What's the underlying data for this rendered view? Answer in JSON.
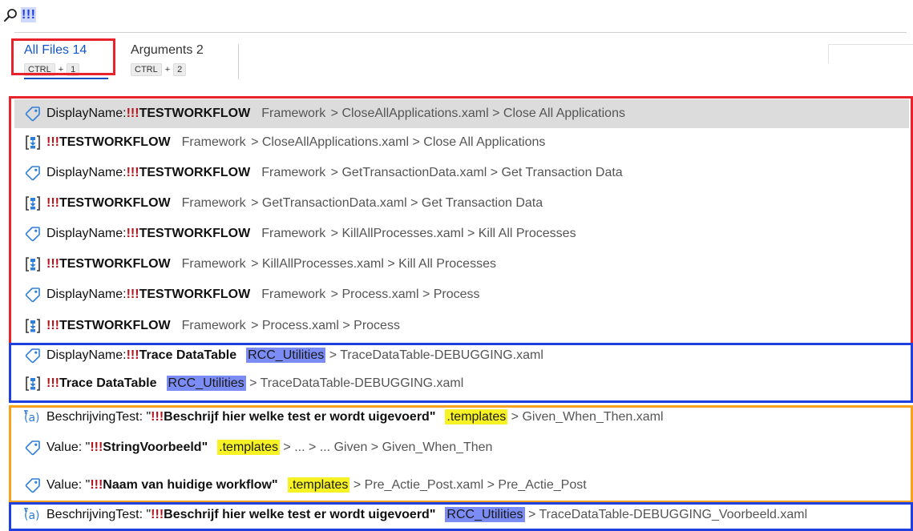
{
  "search": {
    "query": "!!!"
  },
  "tabs": [
    {
      "label": "All Files 14",
      "shortcut": [
        "CTRL",
        "1"
      ]
    },
    {
      "label": "Arguments 2",
      "shortcut": [
        "CTRL",
        "2"
      ]
    }
  ],
  "results": [
    {
      "icon": "tag-icon",
      "prefix": "DisplayName: ",
      "bang": "!!!",
      "match": "TESTWORKFLOW",
      "suffix": "",
      "path": [
        "Framework",
        "CloseAllApplications.xaml",
        "Close All Applications"
      ],
      "highlight": "none",
      "selected": true
    },
    {
      "icon": "sequence-icon",
      "prefix": "",
      "bang": "!!!",
      "match": "TESTWORKFLOW",
      "suffix": "",
      "path": [
        "Framework",
        "CloseAllApplications.xaml",
        "Close All Applications"
      ],
      "highlight": "none",
      "selected": false
    },
    {
      "icon": "tag-icon",
      "prefix": "DisplayName: ",
      "bang": "!!!",
      "match": "TESTWORKFLOW",
      "suffix": "",
      "path": [
        "Framework",
        "GetTransactionData.xaml",
        "Get Transaction Data"
      ],
      "highlight": "none",
      "selected": false
    },
    {
      "icon": "sequence-icon",
      "prefix": "",
      "bang": "!!!",
      "match": "TESTWORKFLOW",
      "suffix": "",
      "path": [
        "Framework",
        "GetTransactionData.xaml",
        "Get Transaction Data"
      ],
      "highlight": "none",
      "selected": false
    },
    {
      "icon": "tag-icon",
      "prefix": "DisplayName: ",
      "bang": "!!!",
      "match": "TESTWORKFLOW",
      "suffix": "",
      "path": [
        "Framework",
        "KillAllProcesses.xaml",
        "Kill All Processes"
      ],
      "highlight": "none",
      "selected": false
    },
    {
      "icon": "sequence-icon",
      "prefix": "",
      "bang": "!!!",
      "match": "TESTWORKFLOW",
      "suffix": "",
      "path": [
        "Framework",
        "KillAllProcesses.xaml",
        "Kill All Processes"
      ],
      "highlight": "none",
      "selected": false
    },
    {
      "icon": "tag-icon",
      "prefix": "DisplayName: ",
      "bang": "!!!",
      "match": "TESTWORKFLOW",
      "suffix": "",
      "path": [
        "Framework",
        "Process.xaml",
        "Process"
      ],
      "highlight": "none",
      "selected": false
    },
    {
      "icon": "sequence-icon",
      "prefix": "",
      "bang": "!!!",
      "match": "TESTWORKFLOW",
      "suffix": "",
      "path": [
        "Framework",
        "Process.xaml",
        "Process"
      ],
      "highlight": "none",
      "selected": false
    },
    {
      "icon": "tag-icon",
      "prefix": "DisplayName: ",
      "bang": "!!!",
      "match": "Trace DataTable",
      "suffix": "",
      "path": [
        "RCC_Utilities",
        "TraceDataTable-DEBUGGING.xaml"
      ],
      "highlight": "blue",
      "selected": false
    },
    {
      "icon": "sequence-icon",
      "prefix": "",
      "bang": "!!!",
      "match": "Trace DataTable",
      "suffix": "",
      "path": [
        "RCC_Utilities",
        "TraceDataTable-DEBUGGING.xaml"
      ],
      "highlight": "blue",
      "selected": false
    },
    {
      "icon": "argument-icon",
      "prefix": "BeschrijvingTest: \"",
      "bang": "!!!",
      "match": "Beschrijf hier welke test er wordt uigevoerd",
      "suffix": "\"",
      "path": [
        ".templates",
        "Given_When_Then.xaml"
      ],
      "highlight": "yellow",
      "selected": false
    },
    {
      "icon": "tag-icon",
      "prefix": "Value: \"",
      "bang": "!!!",
      "match": "StringVoorbeeld",
      "suffix": "\"",
      "path": [
        ".templates",
        "...",
        "... Given",
        "Given_When_Then"
      ],
      "highlight": "yellow",
      "selected": false
    },
    {
      "icon": "tag-icon",
      "prefix": "Value: \"",
      "bang": "!!!",
      "match": "Naam van huidige workflow",
      "suffix": "\"",
      "path": [
        ".templates",
        "Pre_Actie_Post.xaml",
        "Pre_Actie_Post"
      ],
      "highlight": "yellow",
      "selected": false
    },
    {
      "icon": "argument-icon",
      "prefix": "BeschrijvingTest: \"",
      "bang": "!!!",
      "match": "Beschrijf hier welke test er wordt uigevoerd",
      "suffix": "\"",
      "path": [
        "RCC_Utilities",
        "TraceDataTable-DEBUGGING_Voorbeeld.xaml"
      ],
      "highlight": "blue",
      "selected": false
    }
  ],
  "colors": {
    "annotation_red": "#e8232c",
    "annotation_blue": "#1f3fe0",
    "annotation_orange": "#f6a21c",
    "highlight_blue": "#7b8cf5",
    "highlight_yellow": "#f7f224",
    "accent": "#1355c6"
  }
}
